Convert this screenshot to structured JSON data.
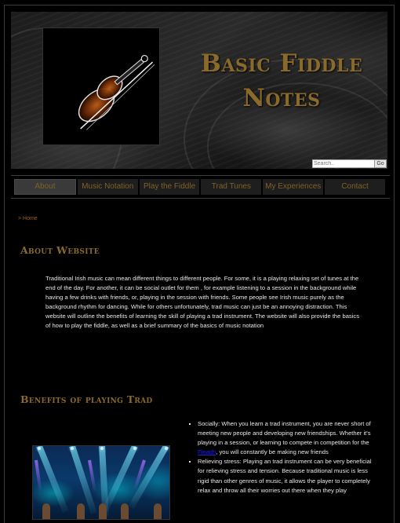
{
  "site": {
    "title_line1": "Basic Fiddle",
    "title_line2": "Notes",
    "logo_icon": "violin-and-bow-icon"
  },
  "search": {
    "placeholder": "Search..",
    "value": "",
    "button_label": "Go"
  },
  "nav": {
    "items": [
      {
        "label": "About",
        "active": true
      },
      {
        "label": "Music Notation",
        "active": false
      },
      {
        "label": "Play the Fiddle",
        "active": false
      },
      {
        "label": "Trad Tunes",
        "active": false
      },
      {
        "label": "My Experiences",
        "active": false
      },
      {
        "label": "Contact",
        "active": false
      }
    ]
  },
  "breadcrumb": {
    "text": "> Home"
  },
  "about": {
    "heading": "About Website",
    "body": "Traditional Irish music can mean different things to different people. For some, it is a playing relaxing set of tunes at the end of the day. For another, it can be social outlet for them , for example listening to a session in the background while having a few drinks with friends, or, playing in the session with friends. Some people see Irish music purely as the background rhythm for dancing. While for others unfortunately, trad music can just be an annoying distraction. This website will outline the benefits of learning the skill of playing a trad instrument. The website will also provide the basics of how to play the fiddle, as well as a brief summary of the basics of music notation"
  },
  "benefits": {
    "heading": "Benefits of playing Trad",
    "image_alt": "concert-stage-photo",
    "items": [
      {
        "before_link": "Socially: When you learn a trad instrument, you are never short of meeting new people and developing new friendships. Whether it's playing in a session, or learning to compete in competition for the ",
        "link": "Fleadh",
        "after_link": ", you will constantly be making new friends"
      },
      {
        "text": "Relieving stress: Playing an trad instrument can be very beneficial for relieving stress and tension. Because traditional music is less rigid than other genres of music, it allows the player to completely relax and throw all their worries out there when they play"
      }
    ]
  },
  "colors": {
    "background": "#000000",
    "accent_gold": "#8a6a2a",
    "nav_text": "#7d6228",
    "breadcrumb": "#a0622a",
    "body_text": "#e8e8e8",
    "link": "#1a1aff"
  }
}
